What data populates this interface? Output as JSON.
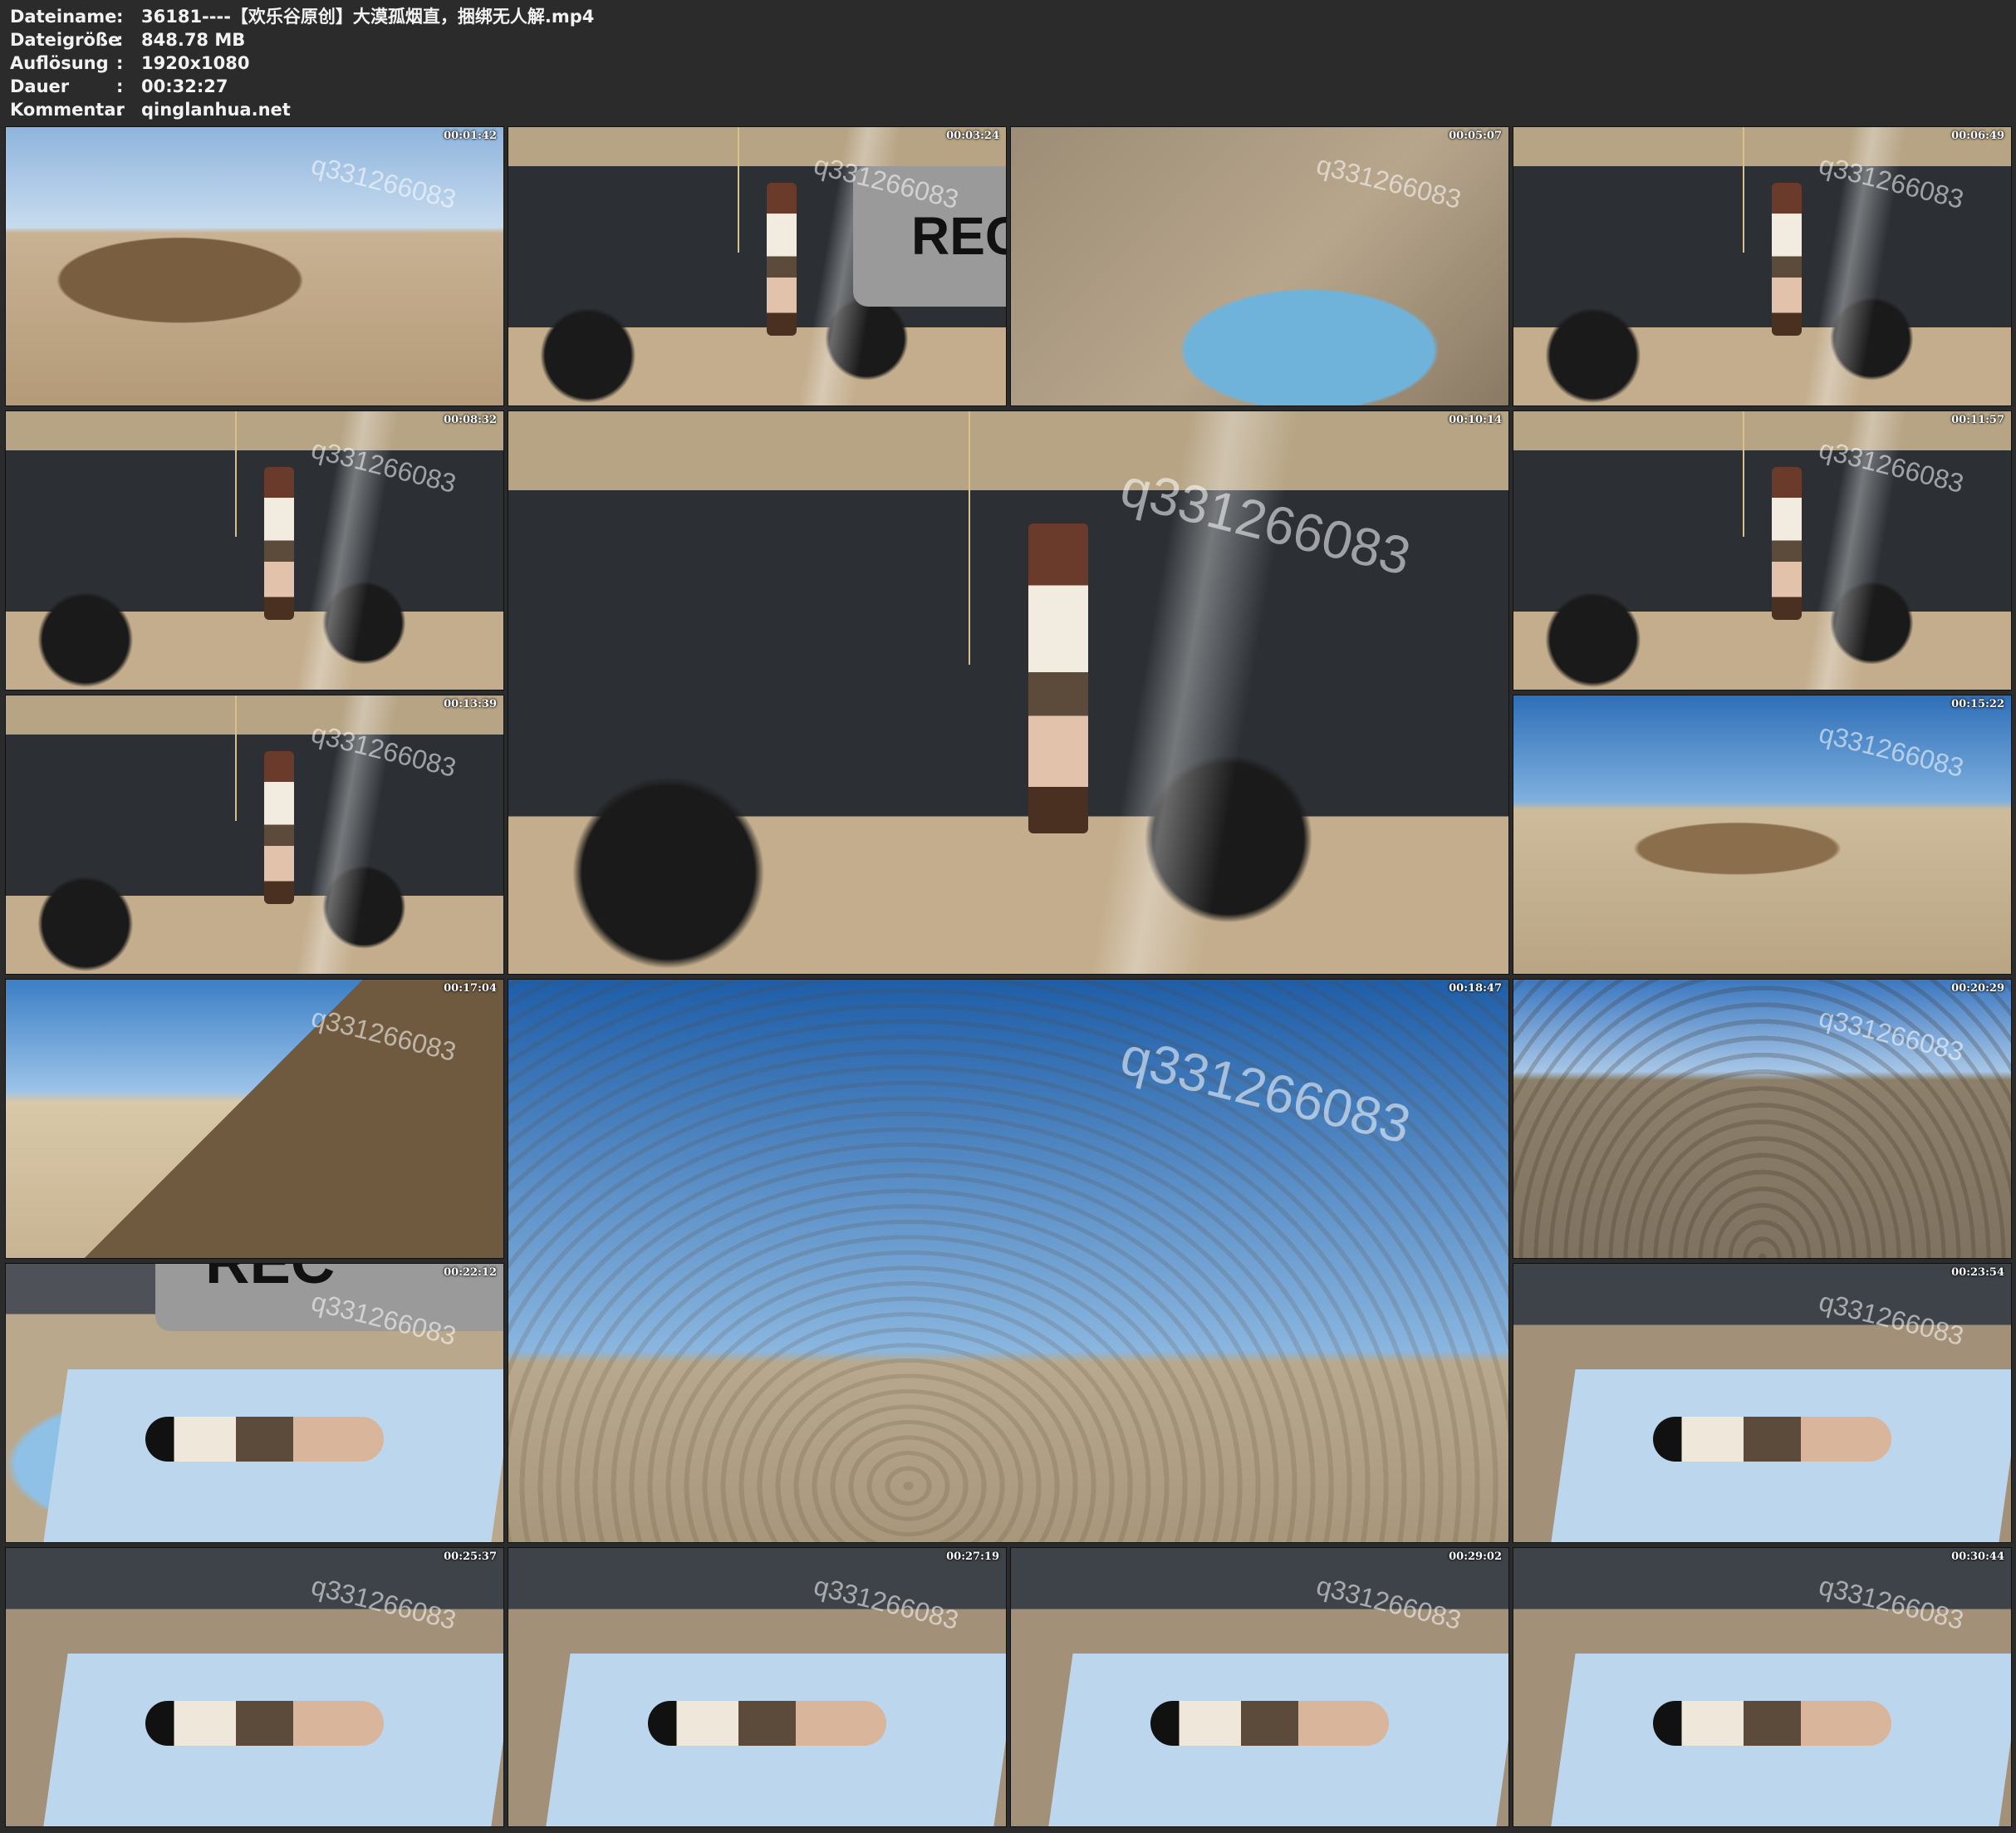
{
  "header": {
    "rows": [
      {
        "label": "Dateiname",
        "sep": ":",
        "value": "36181----【欢乐谷原创】大漠孤烟直，捆绑无人解.mp4"
      },
      {
        "label": "Dateigröße",
        "sep": ":",
        "value": "848.78 MB"
      },
      {
        "label": "Auflösung",
        "sep": ":",
        "value": "1920x1080"
      },
      {
        "label": "Dauer",
        "sep": ":",
        "value": "00:32:27"
      },
      {
        "label": "Kommentar",
        "sep": ":",
        "value": "qinglanhua.net"
      }
    ]
  },
  "watermark": "q331266083",
  "rec_text": "REC",
  "thumbnails": [
    {
      "time": "00:01:42",
      "scene": "mesa"
    },
    {
      "time": "00:03:24",
      "scene": "car-rec"
    },
    {
      "time": "00:05:07",
      "scene": "ground"
    },
    {
      "time": "00:06:49",
      "scene": "car"
    },
    {
      "time": "00:08:32",
      "scene": "car"
    },
    {
      "time": "00:10:14",
      "scene": "car"
    },
    {
      "time": "00:11:57",
      "scene": "car"
    },
    {
      "time": "00:13:39",
      "scene": "car"
    },
    {
      "time": "00:15:22",
      "scene": "desert"
    },
    {
      "time": "00:17:04",
      "scene": "hill"
    },
    {
      "time": "00:18:47",
      "scene": "plain"
    },
    {
      "time": "00:20:29",
      "scene": "plain2"
    },
    {
      "time": "00:22:12",
      "scene": "rec-lying"
    },
    {
      "time": "00:23:54",
      "scene": "lying"
    },
    {
      "time": "00:25:37",
      "scene": "lying"
    },
    {
      "time": "00:27:19",
      "scene": "lying"
    },
    {
      "time": "00:29:02",
      "scene": "lying"
    },
    {
      "time": "00:30:44",
      "scene": "lying"
    }
  ]
}
